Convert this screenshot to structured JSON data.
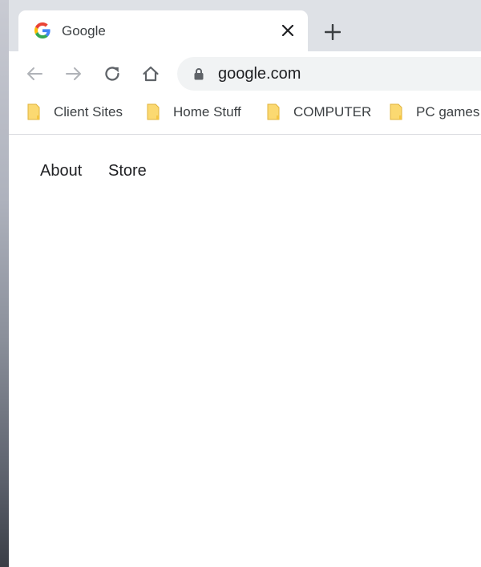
{
  "tab": {
    "title": "Google"
  },
  "omnibox": {
    "url": "google.com"
  },
  "bookmarks": [
    {
      "label": "Client Sites"
    },
    {
      "label": "Home Stuff"
    },
    {
      "label": "COMPUTER"
    },
    {
      "label": "PC games"
    }
  ],
  "page": {
    "links": [
      {
        "label": "About"
      },
      {
        "label": "Store"
      }
    ]
  },
  "icons": {
    "favicon": "google-g-icon",
    "close": "close-icon",
    "new_tab": "plus-icon",
    "back": "arrow-left-icon",
    "forward": "arrow-right-icon",
    "reload": "reload-icon",
    "home": "home-icon",
    "lock": "lock-icon",
    "folder": "folder-icon"
  },
  "colors": {
    "tabstrip": "#dee1e6",
    "omnibox": "#f1f3f4",
    "folder": "#fbd971",
    "google_blue": "#4285f4",
    "google_red": "#ea4335",
    "google_yellow": "#fbbc05",
    "google_green": "#34a853"
  }
}
